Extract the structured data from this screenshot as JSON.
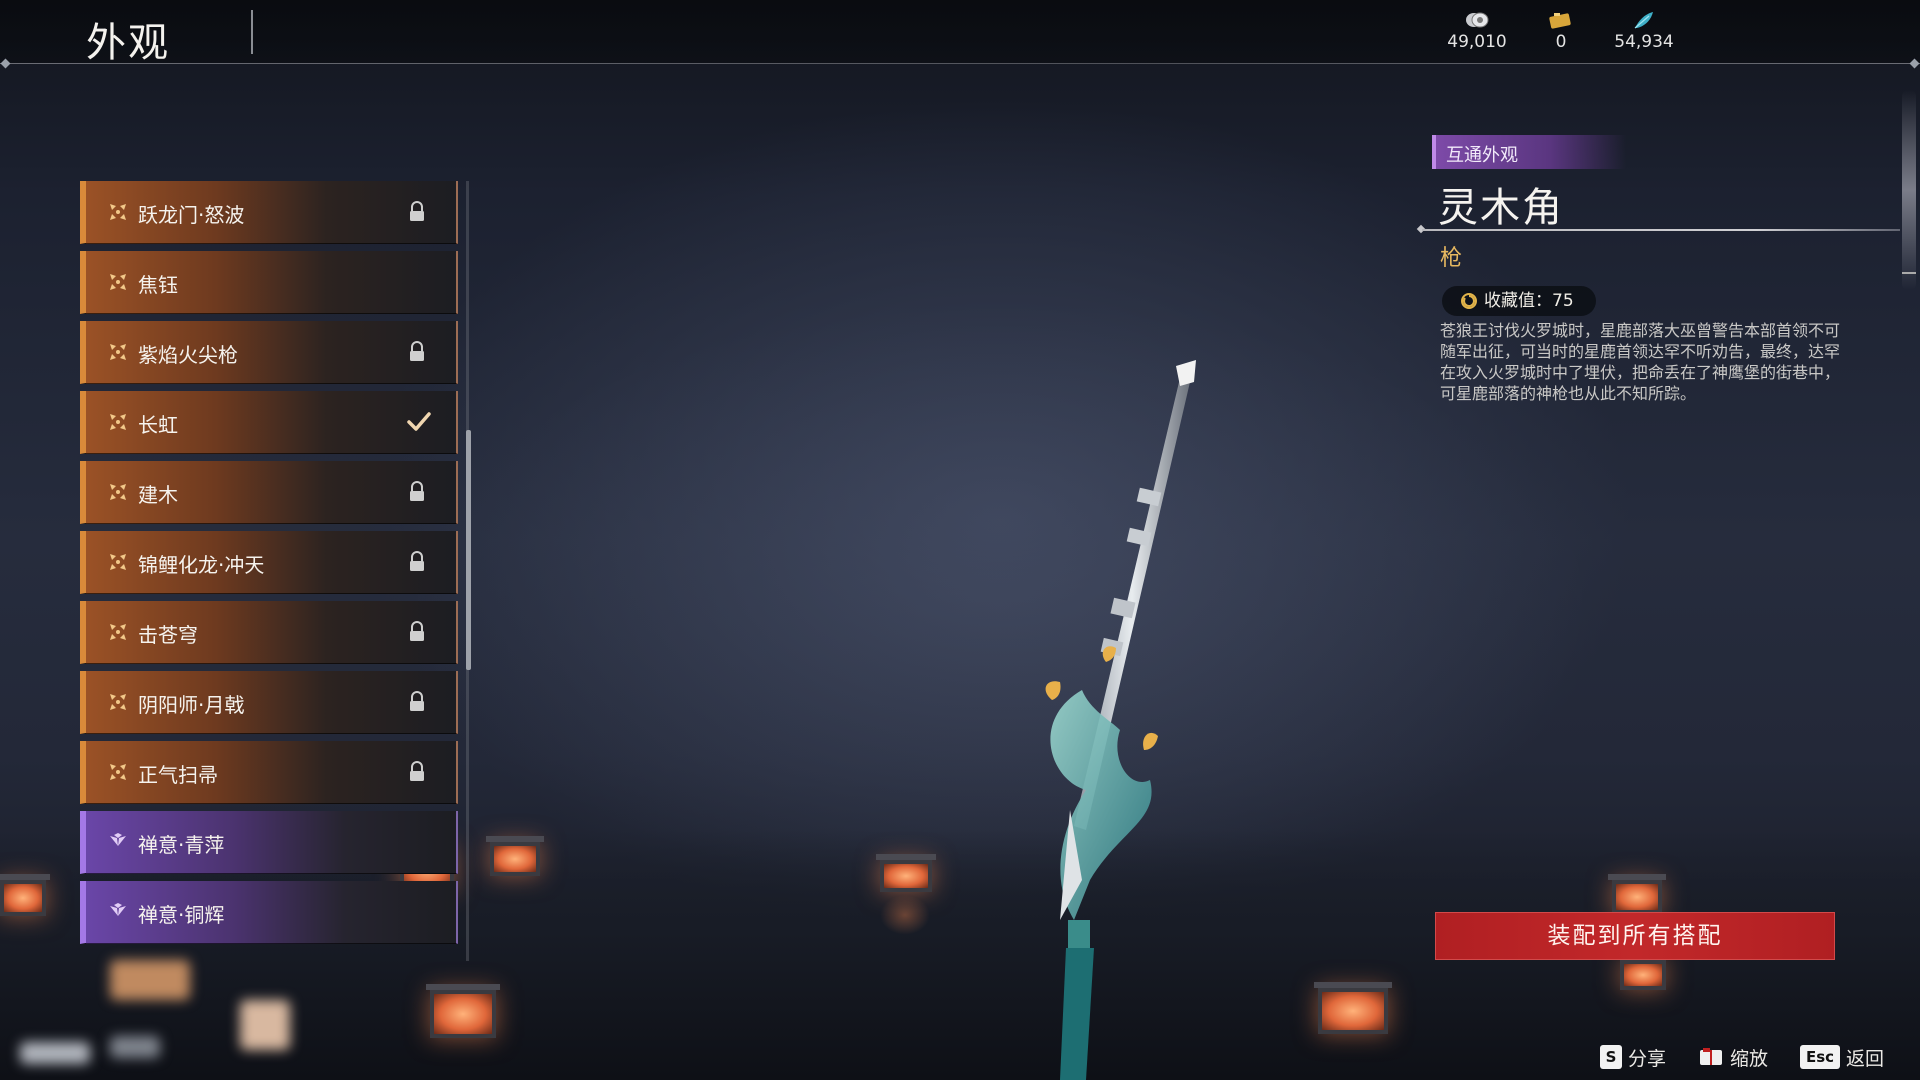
{
  "header": {
    "title": "外观"
  },
  "currencies": [
    {
      "icon": "coin-icon",
      "value": "49,010"
    },
    {
      "icon": "ticket-icon",
      "value": "0"
    },
    {
      "icon": "feather-icon",
      "value": "54,934"
    }
  ],
  "list": {
    "items": [
      {
        "label": "跃龙门·怒波",
        "rarity": "orange",
        "status": "locked"
      },
      {
        "label": "焦钰",
        "rarity": "orange",
        "status": "none"
      },
      {
        "label": "紫焰火尖枪",
        "rarity": "orange",
        "status": "locked"
      },
      {
        "label": "长虹",
        "rarity": "orange",
        "status": "equipped"
      },
      {
        "label": "建木",
        "rarity": "orange",
        "status": "locked"
      },
      {
        "label": "锦鲤化龙·冲天",
        "rarity": "orange",
        "status": "locked"
      },
      {
        "label": "击苍穹",
        "rarity": "orange",
        "status": "locked"
      },
      {
        "label": "阴阳师·月戟",
        "rarity": "orange",
        "status": "locked"
      },
      {
        "label": "正气扫帚",
        "rarity": "orange",
        "status": "locked"
      },
      {
        "label": "禅意·青萍",
        "rarity": "purple",
        "status": "none"
      },
      {
        "label": "禅意·铜辉",
        "rarity": "purple",
        "status": "none"
      }
    ]
  },
  "detail": {
    "tag": "互通外观",
    "name": "灵木角",
    "type": "枪",
    "collection_label": "收藏值：75",
    "description": "苍狼王讨伐火罗城时，星鹿部落大巫曾警告本部首领不可随军出征，可当时的星鹿首领达罕不听劝告，最终，达罕在攻入火罗城时中了埋伏，把命丢在了神鹰堡的街巷中，可星鹿部落的神枪也从此不知所踪。",
    "equip_button": "装配到所有搭配"
  },
  "hints": {
    "share_key": "S",
    "share_label": "分享",
    "zoom_label": "缩放",
    "back_key": "Esc",
    "back_label": "返回"
  },
  "colors": {
    "orange_rarity": "#d98a3a",
    "purple_rarity": "#a478e6",
    "equip_button": "#c2282a",
    "item_type": "#e6b860"
  }
}
